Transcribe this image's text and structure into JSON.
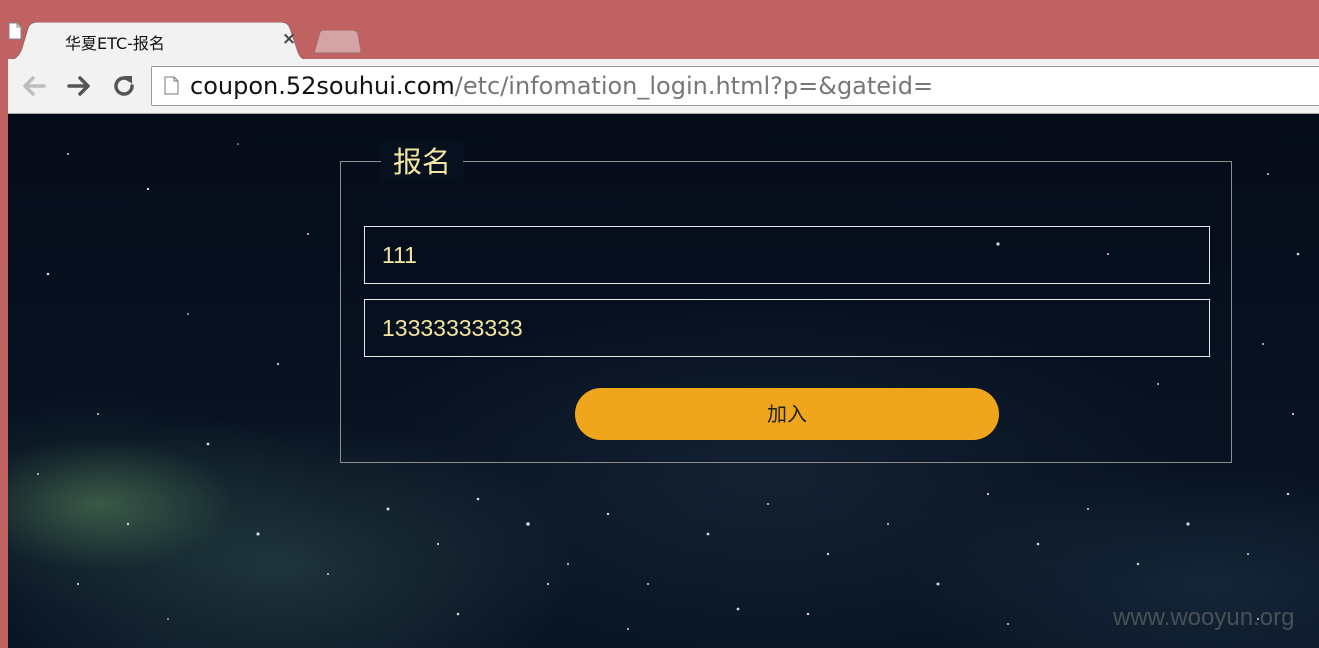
{
  "browser": {
    "tab_title": "华夏ETC-报名",
    "tab_close": "×",
    "url_host": "coupon.52souhui.com",
    "url_path": "/etc/infomation_login.html?p=&gateid="
  },
  "form": {
    "legend": "报名",
    "name_value": "111",
    "phone_value": "13333333333",
    "submit_label": "加入"
  },
  "watermark": "www.wooyun.org",
  "colors": {
    "frame": "#c06162",
    "legend_text": "#f3e6a1",
    "button": "#f0a61c"
  },
  "icons": {
    "tab": "page-icon",
    "back": "back-arrow-icon",
    "forward": "forward-arrow-icon",
    "reload": "reload-icon",
    "omnibox": "page-icon"
  }
}
